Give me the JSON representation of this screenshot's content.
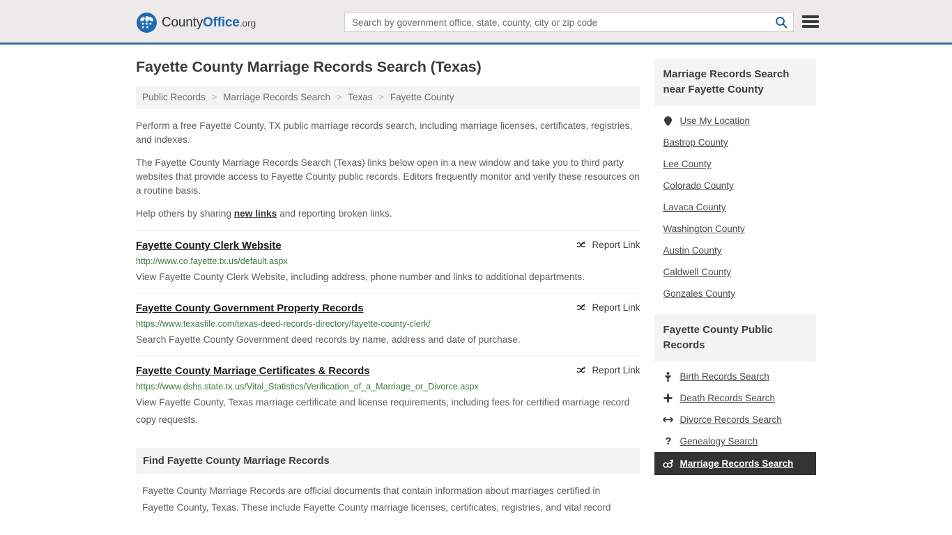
{
  "header": {
    "brand": {
      "part1": "County",
      "part2": "Office",
      "tld": ".org"
    },
    "search": {
      "placeholder": "Search by government office, state, county, city or zip code",
      "value": "",
      "search_icon": "search-icon"
    },
    "menu_icon": "hamburger-menu-icon",
    "accent_color": "#3a6f9f",
    "background_color": "#eceaea"
  },
  "page_title": "Fayette County Marriage Records Search (Texas)",
  "breadcrumb": {
    "separator": ">",
    "items": [
      {
        "label": "Public Records"
      },
      {
        "label": "Marriage Records Search"
      },
      {
        "label": "Texas"
      },
      {
        "label": "Fayette County"
      }
    ]
  },
  "intro": {
    "p1": "Perform a free Fayette County, TX public marriage records search, including marriage licenses, certificates, registries, and indexes.",
    "p2": "The Fayette County Marriage Records Search (Texas) links below open in a new window and take you to third party websites that provide access to Fayette County public records. Editors frequently monitor and verify these resources on a routine basis.",
    "p3_before": "Help others by sharing ",
    "p3_link": "new links",
    "p3_after": " and reporting broken links."
  },
  "results": {
    "report_label": "Report Link",
    "report_icon": "broken-link-icon",
    "items": [
      {
        "title": "Fayette County Clerk Website",
        "url": "http://www.co.fayette.tx.us/default.aspx",
        "desc": "View Fayette County Clerk Website, including address, phone number and links to additional departments."
      },
      {
        "title": "Fayette County Government Property Records",
        "url": "https://www.texasfile.com/texas-deed-records-directory/fayette-county-clerk/",
        "desc": "Search Fayette County Government deed records by name, address and date of purchase."
      },
      {
        "title": "Fayette County Marriage Certificates & Records",
        "url": "https://www.dshs.state.tx.us/Vital_Statistics/Verification_of_a_Marriage_or_Divorce.aspx",
        "desc": "View Fayette County, Texas marriage certificate and license requirements, including fees for certified marriage record copy requests."
      }
    ]
  },
  "find_section": {
    "heading": "Find Fayette County Marriage Records",
    "body": "Fayette County Marriage Records are official documents that contain information about marriages certified in Fayette County, Texas. These include Fayette County marriage licenses, certificates, registries, and vital record"
  },
  "sidebar": {
    "nearby": {
      "heading": "Marriage Records Search near Fayette County",
      "items": [
        {
          "label": "Use My Location",
          "icon": "map-pin-icon"
        },
        {
          "label": "Bastrop County",
          "icon": ""
        },
        {
          "label": "Lee County",
          "icon": ""
        },
        {
          "label": "Colorado County",
          "icon": ""
        },
        {
          "label": "Lavaca County",
          "icon": ""
        },
        {
          "label": "Washington County",
          "icon": ""
        },
        {
          "label": "Austin County",
          "icon": ""
        },
        {
          "label": "Caldwell County",
          "icon": ""
        },
        {
          "label": "Gonzales County",
          "icon": ""
        }
      ]
    },
    "public_records": {
      "heading": "Fayette County Public Records",
      "items": [
        {
          "label": "Birth Records Search",
          "icon": "baby-icon",
          "glyph": "$",
          "active": false
        },
        {
          "label": "Death Records Search",
          "icon": "cross-icon",
          "glyph": "✚",
          "active": false
        },
        {
          "label": "Divorce Records Search",
          "icon": "arrows-apart-icon",
          "glyph": "↔",
          "active": false
        },
        {
          "label": "Genealogy Search",
          "icon": "question-mark-icon",
          "glyph": "?",
          "active": false
        },
        {
          "label": "Marriage Records Search",
          "icon": "male-female-icon",
          "glyph": "⚥",
          "active": true
        }
      ]
    }
  }
}
